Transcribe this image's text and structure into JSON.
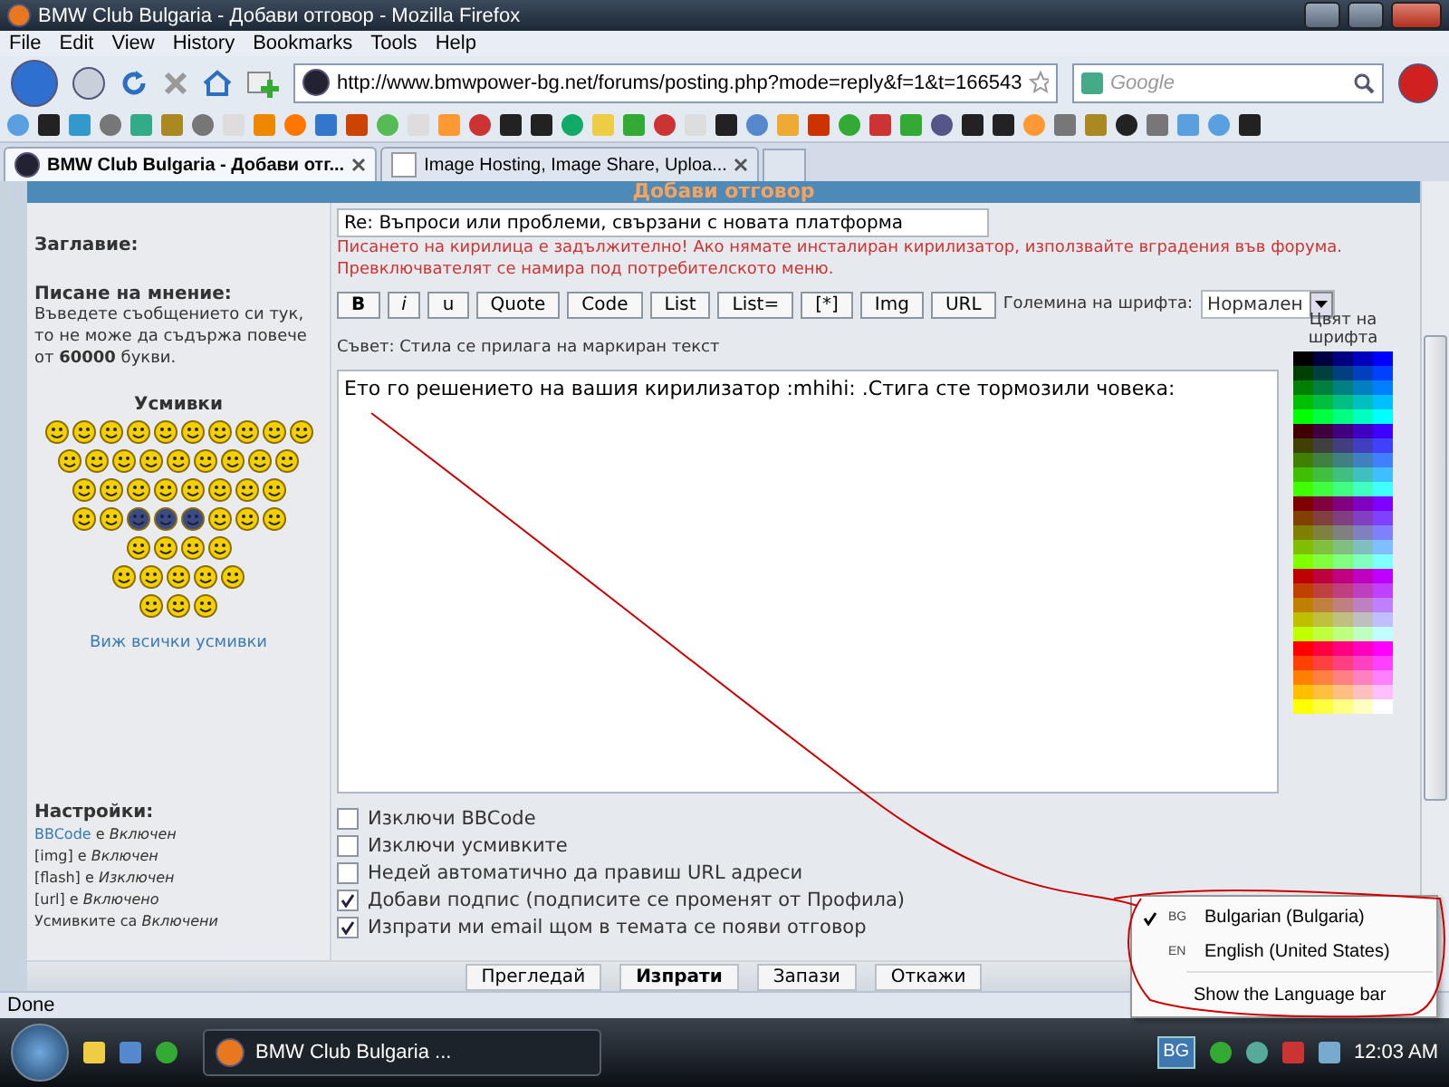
{
  "window": {
    "title": "BMW Club Bulgaria - Добави отговор - Mozilla Firefox"
  },
  "menu_bar": [
    "File",
    "Edit",
    "View",
    "History",
    "Bookmarks",
    "Tools",
    "Help"
  ],
  "nav": {
    "url": "http://www.bmwpower-bg.net/forums/posting.php?mode=reply&f=1&t=166543",
    "search_placeholder": "Google"
  },
  "tabs": [
    {
      "label": "BMW Club Bulgaria - Добави отг...",
      "selected": true
    },
    {
      "label": "Image Hosting, Image Share, Uploa...",
      "selected": false
    }
  ],
  "page": {
    "header": "Добави отговор",
    "subject": {
      "label": "Заглавие:",
      "value": "Re: Въпроси или проблеми, свързани с новата платформа",
      "warning": "Писането на кирилица е задължително! Ако нямате инсталиран кирилизатор, използвайте вградения във форума. Превключвателят се намира под потребителското меню."
    },
    "message": {
      "label": "Писане на мнение:",
      "hint": "Въведете съобщението си тук, то не може да съдържа повече от **60000** букви.",
      "smilies_title": "Усмивки",
      "smilies_link": "Виж всички усмивки",
      "format_buttons": [
        {
          "label": "B",
          "kind": "bold"
        },
        {
          "label": "i",
          "kind": "italic"
        },
        {
          "label": "u",
          "kind": "underline"
        },
        {
          "label": "Quote",
          "kind": "plain"
        },
        {
          "label": "Code",
          "kind": "plain"
        },
        {
          "label": "List",
          "kind": "plain"
        },
        {
          "label": "List=",
          "kind": "plain"
        },
        {
          "label": "[*]",
          "kind": "plain"
        },
        {
          "label": "Img",
          "kind": "plain"
        },
        {
          "label": "URL",
          "kind": "plain"
        }
      ],
      "font_size_label": "Големина на шрифта:",
      "font_size_value": "Нормален",
      "tip": "Съвет: Стила се прилага на маркиран текст",
      "body": "Ето го решението на вашия кирилизатор :mhihi: .Стига сте тормозили човека:",
      "color_label": "Цвят на шрифта"
    },
    "options": {
      "label": "Настройки:",
      "settings": [
        {
          "name": "BBCode",
          "link": true,
          "text": " е *Включен*"
        },
        {
          "name": "[img]",
          "link": false,
          "text": " е *Включен*"
        },
        {
          "name": "[flash]",
          "link": false,
          "text": " е *Изключен*"
        },
        {
          "name": "[url]",
          "link": false,
          "text": " е *Включено*"
        },
        {
          "name": "Усмивките",
          "link": false,
          "text": " са *Включени*"
        }
      ],
      "checkboxes": [
        {
          "label": "Изключи BBCode",
          "checked": false
        },
        {
          "label": "Изключи усмивките",
          "checked": false
        },
        {
          "label": "Недей автоматично да правиш URL адреси",
          "checked": false
        },
        {
          "label": "Добави подпис (подписите се променят от Профила)",
          "checked": true
        },
        {
          "label": "Изпрати ми email щом в темата се появи отговор",
          "checked": true
        }
      ]
    },
    "actions": [
      {
        "label": "Прегледай",
        "kind": "normal"
      },
      {
        "label": "Изпрати",
        "kind": "primary"
      },
      {
        "label": "Запази",
        "kind": "normal"
      },
      {
        "label": "Откажи",
        "kind": "normal"
      }
    ]
  },
  "language_menu": {
    "items": [
      {
        "code": "BG",
        "label": "Bulgarian (Bulgaria)",
        "checked": true
      },
      {
        "code": "EN",
        "label": "English (United States)",
        "checked": false
      }
    ],
    "footer": "Show the Language bar"
  },
  "status_bar": {
    "text": "Done"
  },
  "taskbar": {
    "task": "BMW Club Bulgaria ...",
    "language": "BG",
    "clock": "12:03 AM"
  }
}
